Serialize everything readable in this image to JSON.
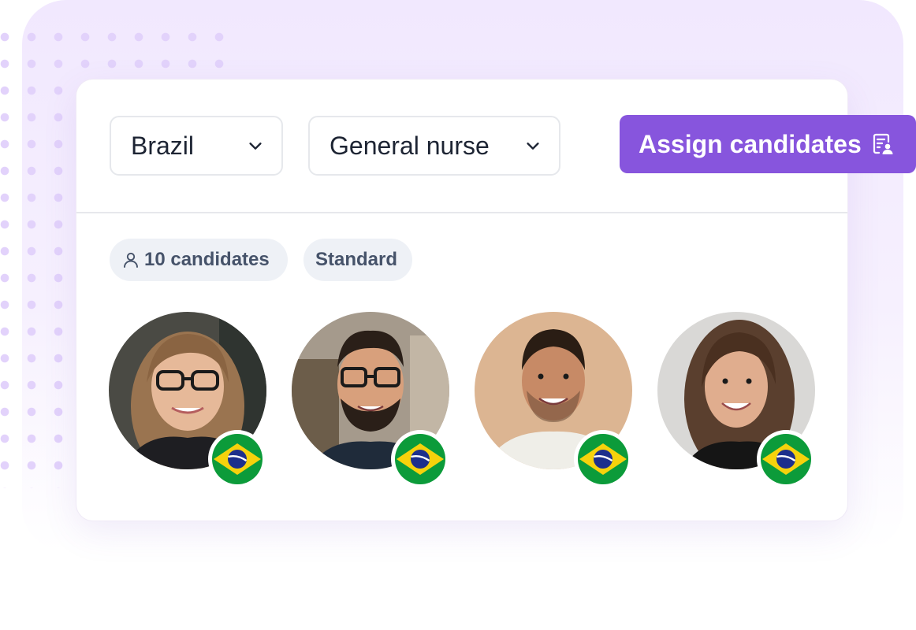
{
  "filters": {
    "country": {
      "value": "Brazil"
    },
    "role": {
      "value": "General nurse"
    }
  },
  "assign_button": {
    "label": "Assign candidates",
    "color": "#8755dd"
  },
  "chips": {
    "candidates": "10 candidates",
    "plan": "Standard"
  },
  "candidates": [
    {
      "photo": "candidate-photo",
      "flag": "brazil-flag-icon"
    },
    {
      "photo": "candidate-photo",
      "flag": "brazil-flag-icon"
    },
    {
      "photo": "candidate-photo",
      "flag": "brazil-flag-icon"
    },
    {
      "photo": "candidate-photo",
      "flag": "brazil-flag-icon"
    }
  ],
  "colors": {
    "accent": "#8755dd",
    "background_tint": "#f1e8fe",
    "chip_bg": "#eef1f6",
    "flag_green": "#0c9b3a",
    "flag_yellow": "#f6d20c",
    "flag_blue": "#1d2f8c"
  }
}
